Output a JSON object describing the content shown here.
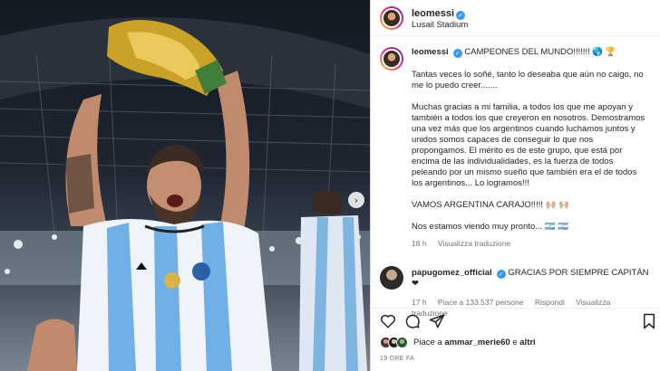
{
  "header": {
    "username": "leomessi",
    "location": "Lusail Stadium"
  },
  "caption": {
    "username": "leomessi",
    "headline": "CAMPEONES DEL MUNDO!!!!!!! 🌎 🏆",
    "paragraphs": [
      "Tantas veces lo soñé, tanto lo deseaba que aún no caigo, no me lo puedo creer.......",
      "Muchas gracias a mi familia, a todos los que me apoyan y también a todos los que creyeron en nosotros. Demostramos una vez más que los argentinos cuando luchamos juntos y unidos somos capaces de conseguir lo que nos propongamos. El mérito es de este grupo, que está por encima de las individualidades, es la fuerza de todos peleando por un mismo sueño que también era el de todos los argentinos... Lo logramos!!!",
      "VAMOS ARGENTINA CARAJO!!!!! 🙌🏼 🙌🏼",
      "Nos estamos viendo muy pronto... 🇦🇷 🇦🇷"
    ],
    "age": "18 h",
    "see_translation": "Visualizza traduzione"
  },
  "comment": {
    "username": "papugomez_official",
    "text": "GRACIAS POR SIEMPRE CAPITÁN ❤",
    "age": "17 h",
    "likes": "Piace a 133.537 persone",
    "reply": "Rispondi",
    "see_translation": "Visualizza traduzione"
  },
  "icons": [
    "heart-outline-icon",
    "comment-icon",
    "share-icon",
    "bookmark-icon",
    "verified-icon",
    "chevron-right-icon"
  ],
  "likes": {
    "prefix": "Piace a",
    "user": "ammar_merie60",
    "and": "e",
    "others": "altri"
  },
  "timestamp": "19 ORE FA",
  "colors": {
    "verified": "#3897f0",
    "heart": "#ed4956",
    "meta": "#737373"
  }
}
